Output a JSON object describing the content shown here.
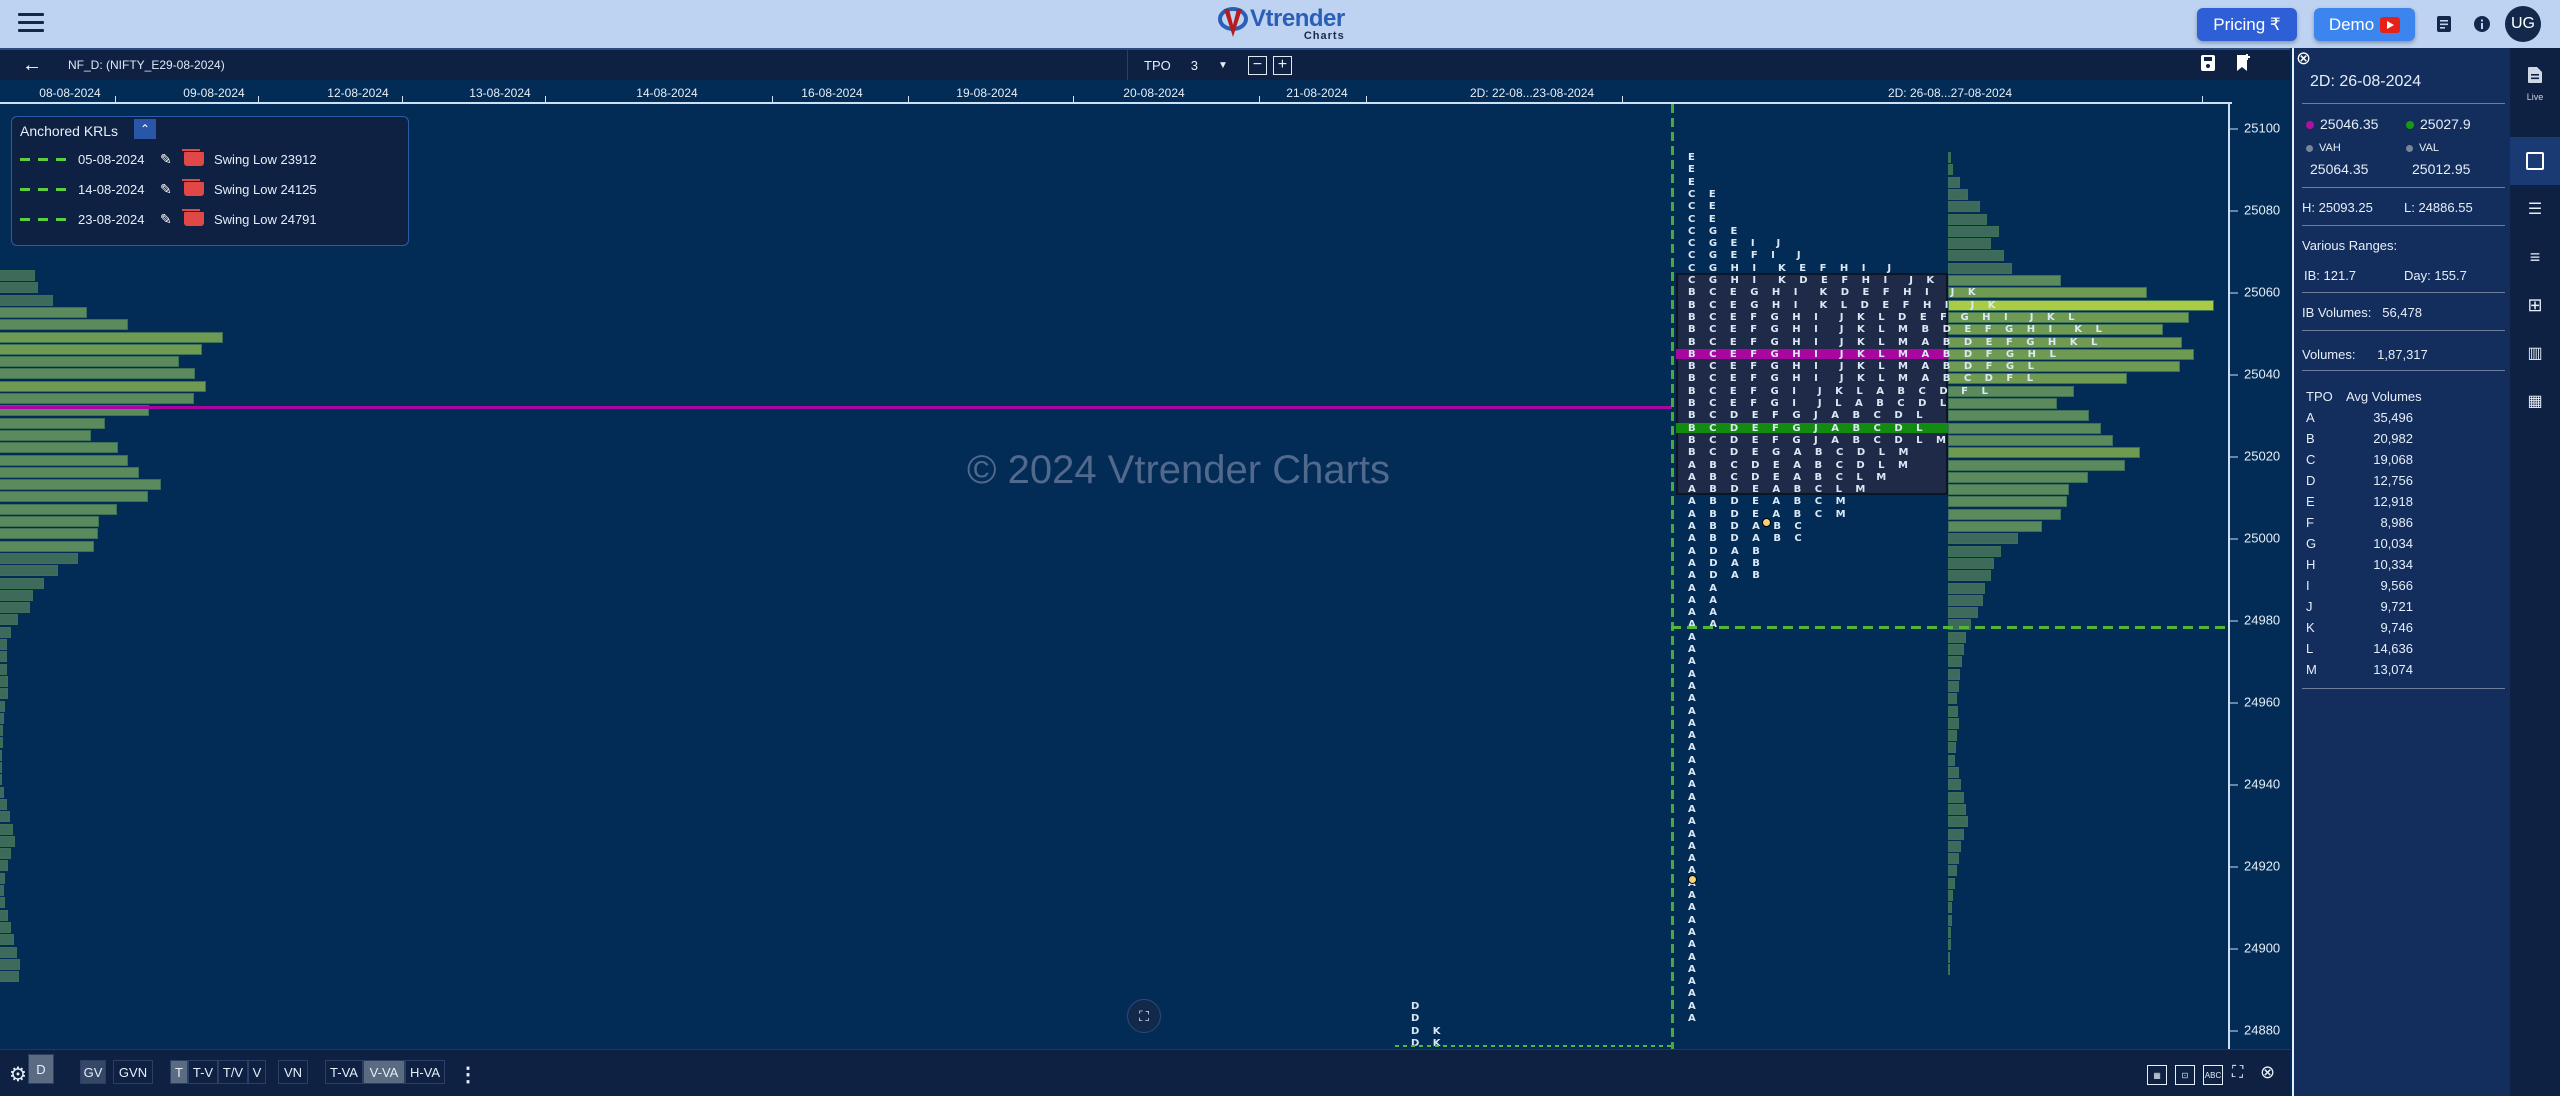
{
  "header": {
    "menu_icon": "hamburger-icon",
    "logo_text": "Vtrender",
    "logo_sub": "Charts",
    "pricing_label": "Pricing ₹",
    "demo_label": "Demo",
    "avatar_initials": "UG"
  },
  "toolbar": {
    "symbol": "NF_D: (NIFTY_E29-08-2024)",
    "tpo_label": "TPO",
    "tpo_value": "3",
    "minus": "−",
    "plus": "+"
  },
  "date_axis": [
    "08-08-2024",
    "09-08-2024",
    "12-08-2024",
    "13-08-2024",
    "14-08-2024",
    "16-08-2024",
    "19-08-2024",
    "20-08-2024",
    "21-08-2024",
    "2D: 22-08...23-08-2024",
    "2D: 26-08...27-08-2024"
  ],
  "price_axis": [
    "25100",
    "25080",
    "25060",
    "25040",
    "25020",
    "25000",
    "24980",
    "24960",
    "24940",
    "24920",
    "24900",
    "24880"
  ],
  "watermark": "© 2024 Vtrender Charts",
  "krl": {
    "title": "Anchored KRLs",
    "items": [
      {
        "date": "05-08-2024",
        "label": "Swing Low 23912"
      },
      {
        "date": "14-08-2024",
        "label": "Swing Low 24125"
      },
      {
        "date": "23-08-2024",
        "label": "Swing Low 24791"
      }
    ]
  },
  "tpo_profile": {
    "rows_above_va": [
      "E",
      "E",
      "E",
      "C E",
      "C E",
      "C E",
      "C G E",
      "C G E I  J",
      "C G E F I  J",
      "C G H I  K E F H I  J"
    ],
    "rows_va": [
      "C G H I  K D E F H I  J K",
      "B C E G H I  K D E F H I  J K",
      "B C E G H I  K L D E F H I  J K",
      "B C E F G H I  J K L D E F G H I  J K L",
      "B C E F G H I  J K L M B D E F G H I  K L",
      "B C E F G H I  J K L M A B D E F G H K L",
      "B C E F G H I  J K L M A B D F G H L",
      "B C E F G H I  J K L M A B D F G L",
      "B C E F G H I  J K L M A B C D F L",
      "B C E F G I  J K L A B C D F L",
      "B C E F G I  J L A B C D L",
      "B C D E F G J A B C D L",
      "B C D E F G J A B C D L",
      "B C D E F G J A B C D L M",
      "B C D E G A B C D L M",
      "A B C D E A B C D L M",
      "A B C D E A B C L M",
      "A B D E A B C L M"
    ],
    "rows_below_va": [
      "A B D E A B C M",
      "A B D E A B C M",
      "A B D A B C",
      "A B D A B C",
      "A D A B",
      "A D A B",
      "A D A B",
      "A A",
      "A A",
      "A A",
      "A A"
    ],
    "single_print_count": 32,
    "single_letter": "A",
    "prev_day_rows": [
      "D",
      "D",
      "D K",
      "D K"
    ],
    "poc_color": "#a8069e",
    "va_mid_color": "#138a10"
  },
  "side_panel": {
    "title": "2D: 26-08-2024",
    "poc_value": "25046.35",
    "poc_color": "#b0109f",
    "vwap_value": "25027.9",
    "vwap_color": "#179a12",
    "vah_label": "VAH",
    "vah_value": "25064.35",
    "val_label": "VAL",
    "val_value": "25012.95",
    "high": "H: 25093.25",
    "low": "L: 24886.55",
    "ranges_label": "Various Ranges:",
    "ib_range": "IB:  121.7",
    "day_range": "Day:  155.7",
    "ib_volumes_label": "IB Volumes:",
    "ib_volumes": "56,478",
    "volumes_label": "Volumes:",
    "volumes": "1,87,317",
    "tpo_header": "TPO",
    "avg_header": "Avg Volumes",
    "tpo_volumes": [
      {
        "tpo": "A",
        "vol": "35,496"
      },
      {
        "tpo": "B",
        "vol": "20,982"
      },
      {
        "tpo": "C",
        "vol": "19,068"
      },
      {
        "tpo": "D",
        "vol": "12,756"
      },
      {
        "tpo": "E",
        "vol": "12,918"
      },
      {
        "tpo": "F",
        "vol": "8,986"
      },
      {
        "tpo": "G",
        "vol": "10,034"
      },
      {
        "tpo": "H",
        "vol": "10,334"
      },
      {
        "tpo": "I",
        "vol": "9,566"
      },
      {
        "tpo": "J",
        "vol": "9,721"
      },
      {
        "tpo": "K",
        "vol": "9,746"
      },
      {
        "tpo": "L",
        "vol": "14,636"
      },
      {
        "tpo": "M",
        "vol": "13,074"
      }
    ]
  },
  "rail": {
    "live_label": "Live"
  },
  "bottom_bar": {
    "buttons": [
      "D",
      "GV",
      "GVN",
      "T",
      "T-V",
      "T/V",
      "V",
      "VN",
      "T-VA",
      "V-VA",
      "H-VA"
    ],
    "active": [
      "D",
      "T",
      "V-VA"
    ]
  },
  "volume_profile_right": [
    0.3,
    0.6,
    1.3,
    2.2,
    3.6,
    4.4,
    5.8,
    4.8,
    6.3,
    7.2,
    12.8,
    22.4,
    30.0,
    27.2,
    24.3,
    26.4,
    27.7,
    26.2,
    20.2,
    14.2,
    12.3,
    15.9,
    17.2,
    18.6,
    21.6,
    20.0,
    15.8,
    13.6,
    13.4,
    12.8,
    10.6,
    7.9,
    6.0,
    5.2,
    4.8,
    4.2,
    3.9,
    3.4,
    2.6,
    2.0,
    1.8,
    1.6,
    1.4,
    1.2,
    1.0,
    1.1,
    1.2,
    1.0,
    0.9,
    0.8,
    1.2,
    1.5,
    1.8,
    2.0,
    2.2,
    1.8,
    1.5,
    1.2,
    1.0,
    0.8,
    0.6,
    0.5,
    0.4,
    0.3,
    0.3,
    0.2,
    0.2
  ],
  "volume_profile_left": [
    3.6,
    3.9,
    5.4,
    8.8,
    12.9,
    22.4,
    20.3,
    18.0,
    19.6,
    20.7,
    19.5,
    15.0,
    10.6,
    9.2,
    11.9,
    12.9,
    14.0,
    16.2,
    14.9,
    11.8,
    10.0,
    9.9,
    9.5,
    7.9,
    5.9,
    4.5,
    3.4,
    3.1,
    1.9,
    1.2,
    0.8,
    0.8,
    0.8,
    0.9,
    0.9,
    0.6,
    0.5,
    0.4,
    0.4,
    0.3,
    0.3,
    0.3,
    0.5,
    0.8,
    1.1,
    1.4,
    1.6,
    1.2,
    0.9,
    0.6,
    0.5,
    0.6,
    0.9,
    1.2,
    1.5,
    1.8,
    2.1,
    2.0
  ]
}
